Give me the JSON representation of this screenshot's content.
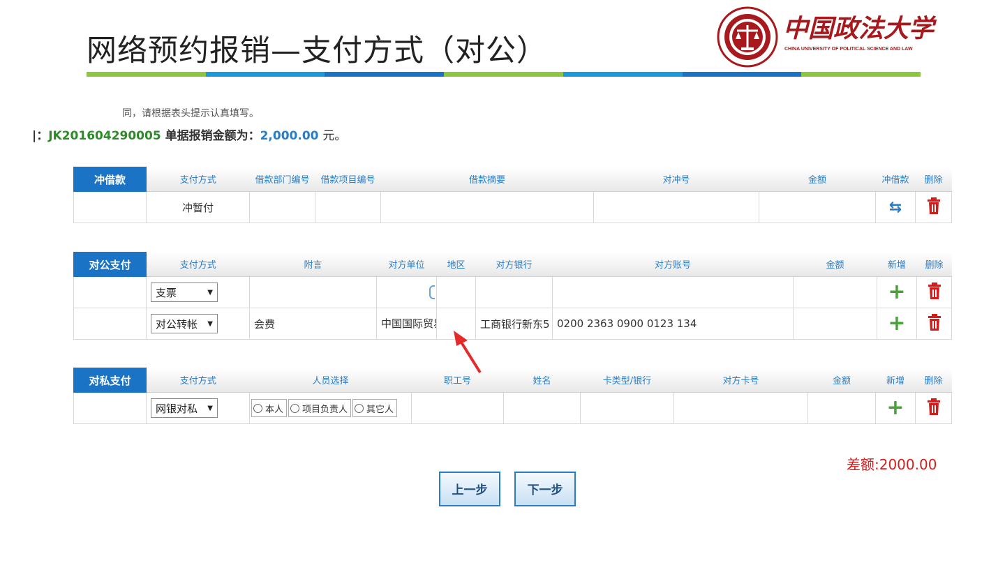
{
  "slide": {
    "title": "网络预约报销—支付方式（对公）",
    "title_bar_colors": [
      "#8dc63f",
      "#1a9ad6",
      "#8dc63f",
      "#1a9ad6",
      "#1a73c4",
      "#8dc63f",
      "#1a9ad6",
      "#8dc63f"
    ]
  },
  "logo": {
    "cn_name": "中国政法大学",
    "en_name": "CHINA UNIVERSITY OF POLITICAL SCIENCE AND LAW",
    "color": "#a7191c"
  },
  "notice": {
    "line1": "同，请根据表头提示认真填写。",
    "prefix": "|：",
    "doc_no": "JK201604290005",
    "amount_label": "单据报销金额为：",
    "amount": "2,000.00",
    "unit": "元。"
  },
  "loan_section": {
    "label": "冲借款",
    "headers": [
      "支付方式",
      "借款部门编号",
      "借款项目编号",
      "借款摘要",
      "对冲号",
      "金额",
      "冲借款",
      "删除"
    ],
    "rows": [
      {
        "method": "冲暂付"
      }
    ]
  },
  "public_section": {
    "label": "对公支付",
    "headers": [
      "支付方式",
      "附言",
      "对方单位",
      "地区",
      "对方银行",
      "对方账号",
      "金额",
      "新增",
      "删除"
    ],
    "rows": [
      {
        "method": "支票",
        "remark": "",
        "company": "",
        "region": "",
        "bank": "",
        "account": ""
      },
      {
        "method": "对公转帐",
        "remark": "会费",
        "company": "中国国际贸易:",
        "region": "",
        "bank": "工商银行新东5",
        "account": "0200 2363 0900 0123 134"
      }
    ]
  },
  "private_section": {
    "label": "对私支付",
    "headers": [
      "支付方式",
      "人员选择",
      "职工号",
      "姓名",
      "卡类型/银行",
      "对方卡号",
      "金额",
      "新增",
      "删除"
    ],
    "rows": [
      {
        "method": "网银对私",
        "options": [
          "本人",
          "项目负责人",
          "其它人"
        ]
      }
    ]
  },
  "difference": "差额:2000.00",
  "buttons": {
    "prev": "上一步",
    "next": "下一步"
  },
  "icons": {
    "add": "plus-icon",
    "delete": "trash-icon",
    "offset": "swap-icon"
  }
}
